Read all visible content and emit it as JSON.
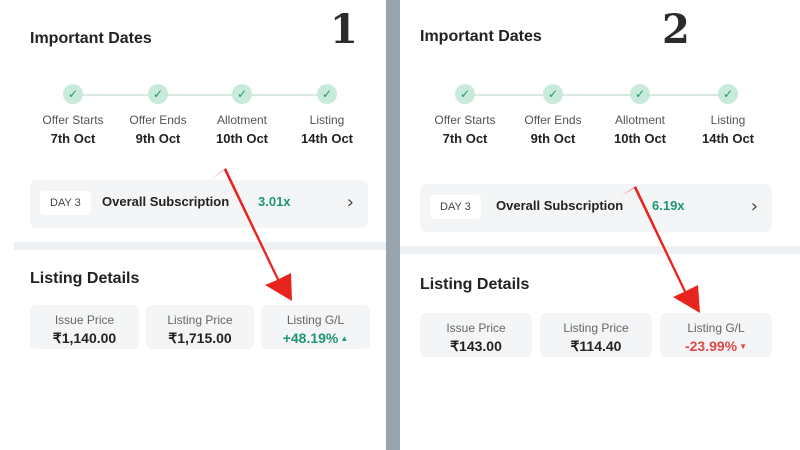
{
  "panels": [
    {
      "badge": "1",
      "title": "Important Dates",
      "steps": [
        {
          "label": "Offer Starts",
          "date": "7th Oct"
        },
        {
          "label": "Offer Ends",
          "date": "9th Oct"
        },
        {
          "label": "Allotment",
          "date": "10th Oct"
        },
        {
          "label": "Listing",
          "date": "14th Oct"
        }
      ],
      "subscription": {
        "day": "DAY 3",
        "label": "Overall Subscription",
        "value": "3.01x"
      },
      "listing_title": "Listing Details",
      "listing": [
        {
          "label": "Issue Price",
          "value": "₹1,140.00"
        },
        {
          "label": "Listing Price",
          "value": "₹1,715.00"
        },
        {
          "label": "Listing G/L",
          "value": "+48.19%",
          "trend": "up"
        }
      ]
    },
    {
      "badge": "2",
      "title": "Important Dates",
      "steps": [
        {
          "label": "Offer Starts",
          "date": "7th Oct"
        },
        {
          "label": "Offer Ends",
          "date": "9th Oct"
        },
        {
          "label": "Allotment",
          "date": "10th Oct"
        },
        {
          "label": "Listing",
          "date": "14th Oct"
        }
      ],
      "subscription": {
        "day": "DAY 3",
        "label": "Overall Subscription",
        "value": "6.19x"
      },
      "listing_title": "Listing Details",
      "listing": [
        {
          "label": "Issue Price",
          "value": "₹143.00"
        },
        {
          "label": "Listing Price",
          "value": "₹114.40"
        },
        {
          "label": "Listing G/L",
          "value": "-23.99%",
          "trend": "down"
        }
      ]
    }
  ],
  "icons": {
    "step": "check-icon",
    "chevron": "chevron-right-icon",
    "up": "triangle-up-icon",
    "down": "triangle-down-icon",
    "arrow": "red-arrow-icon"
  },
  "colors": {
    "positive": "#1f9670",
    "negative": "#e04848",
    "arrow": "#e8241e",
    "divider": "#97a4ad"
  }
}
